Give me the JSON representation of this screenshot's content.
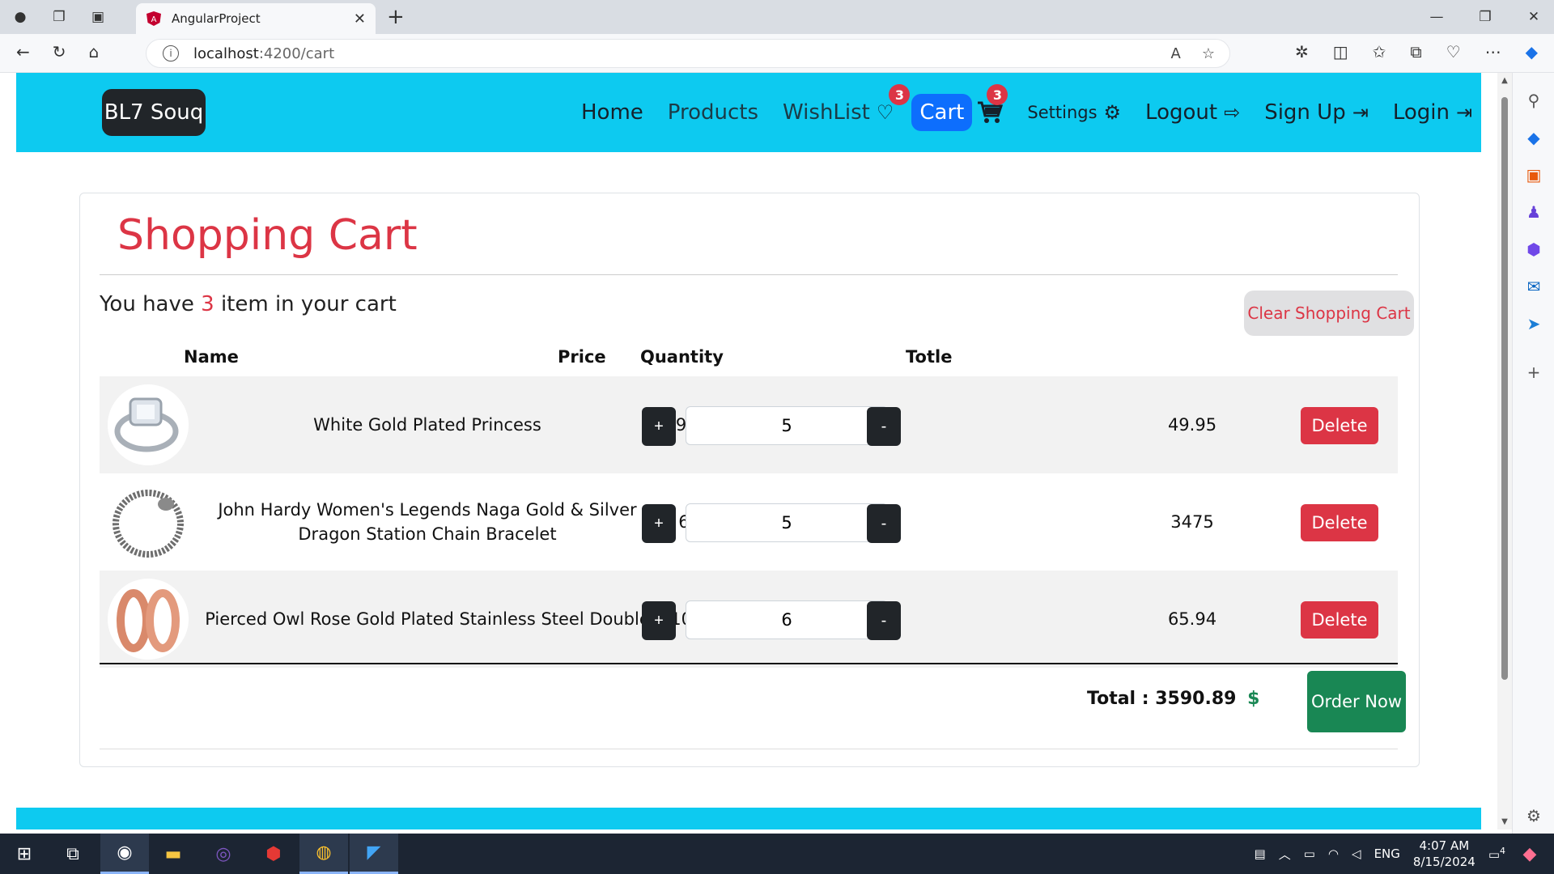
{
  "browser": {
    "tab_title": "AngularProject",
    "url_host": "localhost",
    "url_path": ":4200/cart"
  },
  "navbar": {
    "brand": "BL7 Souq",
    "items": {
      "home": "Home",
      "products": "Products",
      "wishlist": "WishList",
      "wishlist_badge": "3",
      "cart": "Cart",
      "cart_badge": "3",
      "settings": "Settings",
      "logout": "Logout",
      "signup": "Sign Up",
      "login": "Login"
    }
  },
  "cart": {
    "title": "Shopping Cart",
    "count_prefix": "You have",
    "count": "3",
    "count_suffix": "item in your cart",
    "clear_label": "Clear Shopping Cart",
    "headers": {
      "name": "Name",
      "price": "Price",
      "quantity": "Quantity",
      "total": "Totle"
    },
    "items": [
      {
        "name": "White Gold Plated Princess",
        "price": "9.99",
        "qty": "5",
        "total": "49.95"
      },
      {
        "name": "John Hardy Women's Legends Naga Gold & Silver Dragon Station Chain Bracelet",
        "price": "695",
        "qty": "5",
        "total": "3475"
      },
      {
        "name": "Pierced Owl Rose Gold Plated Stainless Steel Double",
        "price": "10.99",
        "qty": "6",
        "total": "65.94"
      }
    ],
    "currency": "$",
    "plus": "+",
    "minus": "-",
    "delete_label": "Delete",
    "total_label": "Total :",
    "total_value": "3590.89",
    "order_label": "Order Now"
  },
  "taskbar": {
    "lang": "ENG",
    "time": "4:07 AM",
    "date": "8/15/2024",
    "notif_count": "4"
  }
}
